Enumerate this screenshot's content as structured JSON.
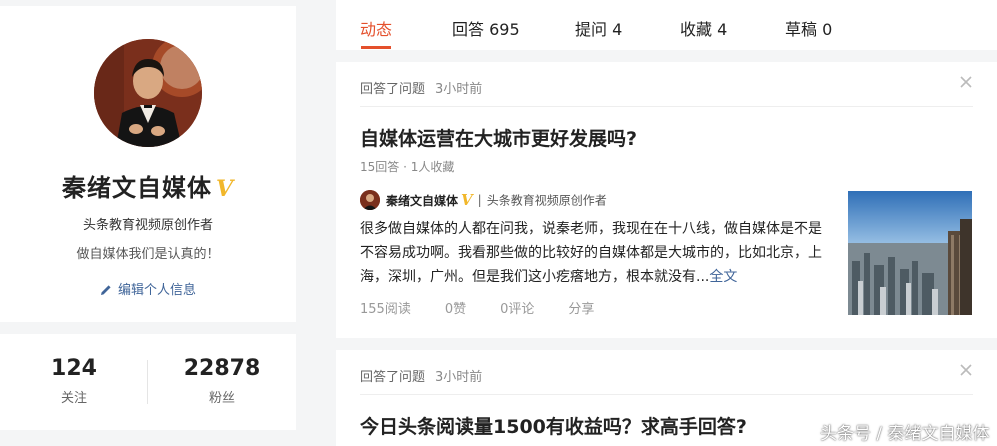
{
  "profile": {
    "name": "秦绪文自媒体",
    "verified_badge": "V",
    "subtitle": "头条教育视频原创作者",
    "signature": "做自媒体我们是认真的！",
    "edit_label": "编辑个人信息",
    "accent_color": "#f1b72b"
  },
  "stats": [
    {
      "value": "124",
      "label": "关注"
    },
    {
      "value": "22878",
      "label": "粉丝"
    }
  ],
  "tabs": [
    {
      "label": "动态",
      "active": true
    },
    {
      "label": "回答 695"
    },
    {
      "label": "提问 4"
    },
    {
      "label": "收藏 4"
    },
    {
      "label": "草稿 0"
    }
  ],
  "feed": [
    {
      "action": "回答了问题",
      "time": "3小时前",
      "title": "自媒体运营在大城市更好发展吗?",
      "sub": "15回答 · 1人收藏",
      "author": {
        "name": "秦绪文自媒体",
        "badge": "V",
        "sep": "|",
        "desc": "头条教育视频原创作者"
      },
      "excerpt": "很多做自媒体的人都在问我，说秦老师，我现在在十八线，做自媒体是不是不容易成功啊。我看那些做的比较好的自媒体都是大城市的，比如北京，上海，深圳，广州。但是我们这小疙瘩地方，根本就没有...",
      "more": "全文",
      "actions": {
        "reads": "155阅读",
        "likes": "0赞",
        "comments": "0评论",
        "share": "分享"
      }
    },
    {
      "action": "回答了问题",
      "time": "3小时前",
      "title": "今日头条阅读量1500有收益吗？求高手回答?"
    }
  ],
  "watermark": "头条号 / 秦绪文自媒体",
  "colors": {
    "accent": "#e4502c",
    "link": "#406599"
  }
}
